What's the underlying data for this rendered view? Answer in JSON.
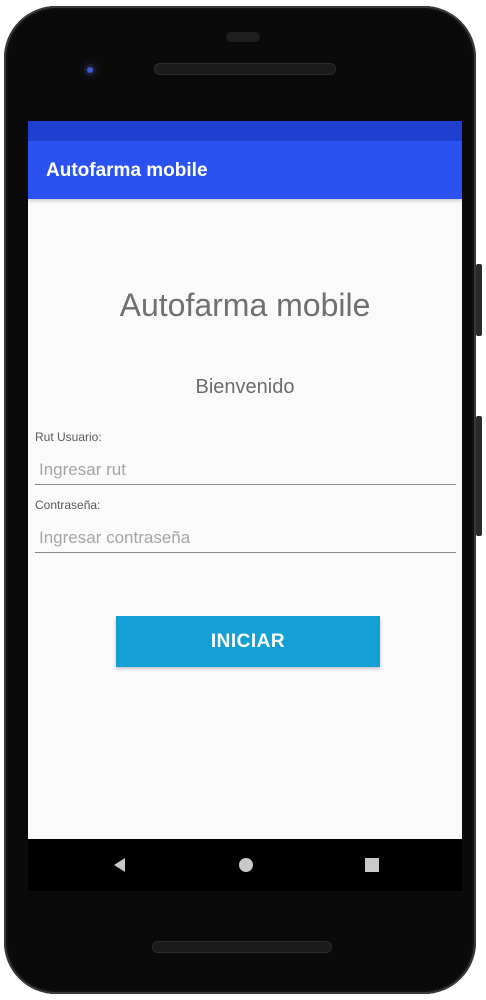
{
  "app_bar": {
    "title": "Autofarma mobile"
  },
  "login": {
    "heading": "Autofarma mobile",
    "welcome": "Bienvenido",
    "rut": {
      "label": "Rut Usuario:",
      "placeholder": "Ingresar rut",
      "value": ""
    },
    "password": {
      "label": "Contraseña:",
      "placeholder": "Ingresar contraseña",
      "value": ""
    },
    "submit_label": "INICIAR"
  },
  "nav": {
    "back_icon": "back-triangle-icon",
    "home_icon": "home-circle-icon",
    "recents_icon": "recents-square-icon"
  },
  "colors": {
    "app_bar": "#2a52f0",
    "status_bar": "#1f3fd0",
    "button": "#14a0d4",
    "screen_bg": "#fafafa"
  }
}
